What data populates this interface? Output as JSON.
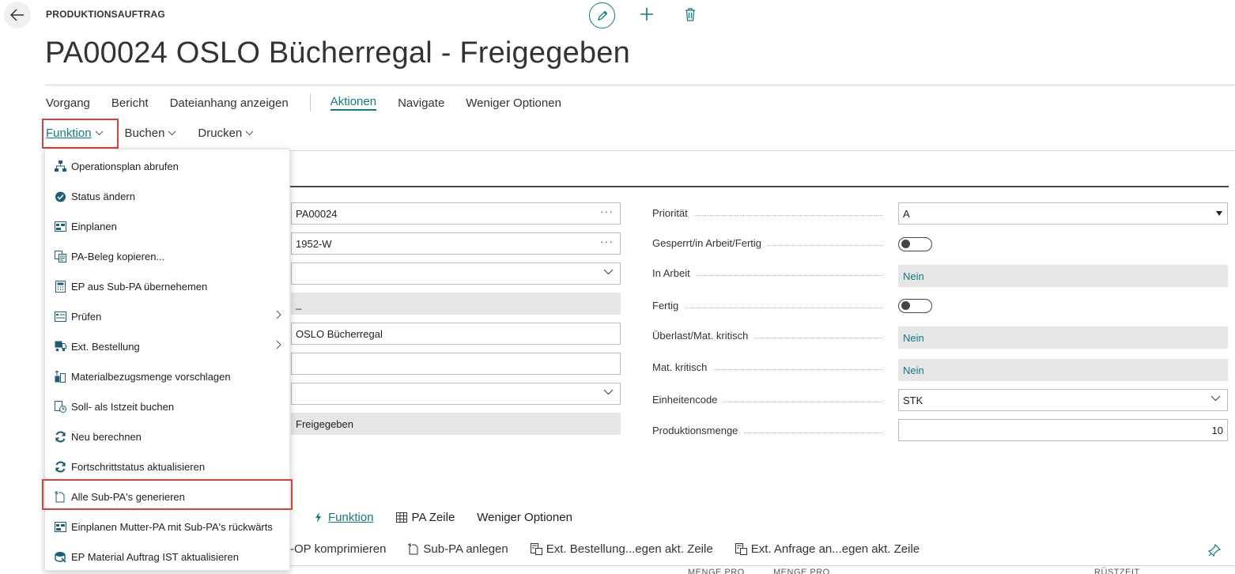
{
  "header": {
    "eyebrow": "PRODUKTIONSAUFTRAG",
    "title": "PA00024 OSLO Bücherregal - Freigegeben"
  },
  "menu": {
    "row1": [
      "Vorgang",
      "Bericht",
      "Dateianhang anzeigen",
      "Aktionen",
      "Navigate",
      "Weniger Optionen"
    ],
    "row2": [
      "Funktion",
      "Buchen",
      "Drucken"
    ]
  },
  "dropdown": {
    "items": [
      "Operationsplan abrufen",
      "Status ändern",
      "Einplanen",
      "PA-Beleg kopieren...",
      "EP aus Sub-PA übernehemen",
      "Prüfen",
      "Ext. Bestellung",
      "Materialbezugsmenge vorschlagen",
      "Soll- als Istzeit buchen",
      "Neu berechnen",
      "Fortschrittstatus aktualisieren",
      "Alle Sub-PA's generieren",
      "Einplanen Mutter-PA mit Sub-PA's rückwärts",
      "EP Material Auftrag IST aktualisieren"
    ]
  },
  "form": {
    "left": {
      "nr": "PA00024",
      "source": "1952-W",
      "dash": "_",
      "description": "OSLO Bücherregal",
      "status": "Freigegeben"
    },
    "right": {
      "labels": [
        "Priorität",
        "Gesperrt/in Arbeit/Fertig",
        "In Arbeit",
        "Fertig",
        "Überlast/Mat. kritisch",
        "Mat. kritisch",
        "Einheitencode",
        "Produktionsmenge"
      ],
      "prioritaet": "A",
      "in_arbeit": "Nein",
      "ueberlast": "Nein",
      "mat_kritisch": "Nein",
      "einheitencode": "STK",
      "produktionsmenge": "10"
    }
  },
  "bottom": {
    "tabs": [
      "Funktion",
      "PA Zeile",
      "Weniger Optionen"
    ],
    "actions": [
      "-OP komprimieren",
      "Sub-PA anlegen",
      "Ext. Bestellung...egen akt. Zeile",
      "Ext. Anfrage an...egen akt. Zeile"
    ],
    "col_heads": [
      "MENGE PRO",
      "MENGE PRO",
      "RÜSTZEIT"
    ]
  },
  "colors": {
    "accent": "#0f7b84",
    "highlight": "#d9423a"
  }
}
